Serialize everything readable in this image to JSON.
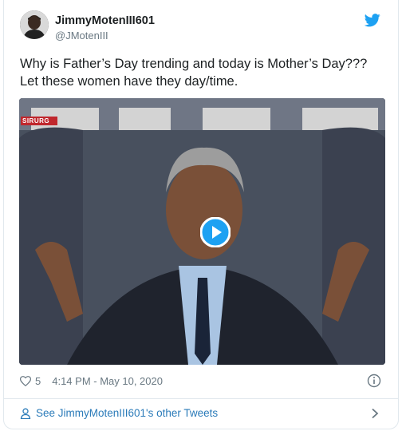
{
  "author": {
    "display_name": "JimmyMotenIII601",
    "handle": "@JMotenIII"
  },
  "tweet": {
    "text": "Why is Father’s Day trending and today is Mother’s Day??? Let these women have they day/time."
  },
  "media": {
    "network_bug": "SIRURG",
    "play_icon": "play-icon"
  },
  "footer": {
    "like_icon": "heart-icon",
    "like_count": "5",
    "timestamp": "4:14 PM - May 10, 2020",
    "info_icon": "info-icon"
  },
  "more": {
    "link_text": "See JimmyMotenIII601's other Tweets",
    "chevron_icon": "chevron-right-icon"
  },
  "colors": {
    "link_blue": "#2b7bb9",
    "twitter_blue": "#1da1f2",
    "muted_text": "#697882",
    "border": "#e1e8ed"
  }
}
